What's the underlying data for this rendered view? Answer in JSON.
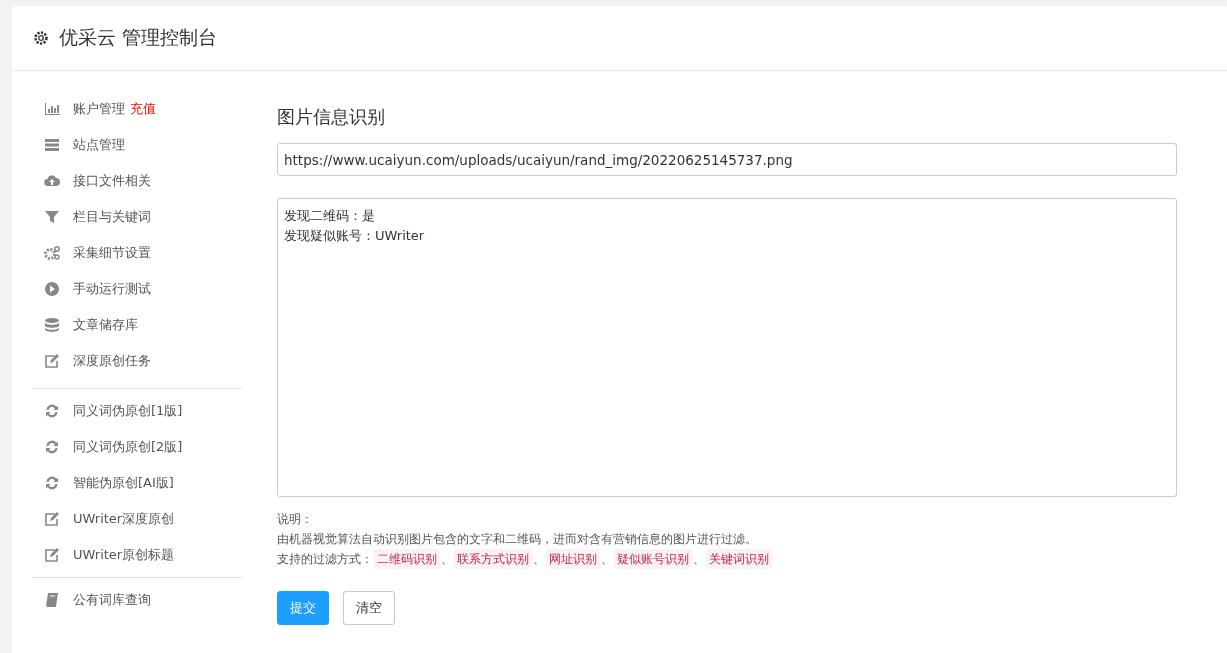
{
  "header": {
    "title": "优采云 管理控制台"
  },
  "sidebar": {
    "groups": [
      {
        "items": [
          {
            "label": "账户管理",
            "badge": "充值",
            "kind": "bars"
          },
          {
            "label": "站点管理",
            "kind": "server"
          },
          {
            "label": "接口文件相关",
            "kind": "cloud"
          },
          {
            "label": "栏目与关键词",
            "kind": "filter"
          },
          {
            "label": "采集细节设置",
            "kind": "gears"
          },
          {
            "label": "手动运行测试",
            "kind": "play"
          },
          {
            "label": "文章储存库",
            "kind": "db"
          },
          {
            "label": "深度原创任务",
            "kind": "edit"
          }
        ]
      },
      {
        "items": [
          {
            "label": "同义词伪原创[1版]",
            "kind": "refresh"
          },
          {
            "label": "同义词伪原创[2版]",
            "kind": "refresh"
          },
          {
            "label": "智能伪原创[AI版]",
            "kind": "refresh"
          },
          {
            "label": "UWriter深度原创",
            "kind": "edit"
          },
          {
            "label": "UWriter原创标题",
            "kind": "edit"
          }
        ]
      },
      {
        "items": [
          {
            "label": "公有词库查询",
            "kind": "book"
          }
        ]
      }
    ]
  },
  "main": {
    "title": "图片信息识别",
    "url_field": {
      "value": "https://www.ucaiyun.com/uploads/ucaiyun/rand_img/20220625145737.png"
    },
    "result_lines": [
      "发现二维码：是",
      "发现疑似账号：UWriter"
    ],
    "note_label": "说明：",
    "note_text": "由机器视觉算法自动识别图片包含的文字和二维码，进而对含有营销信息的图片进行过滤。",
    "filter_label": "支持的过滤方式：",
    "filters": [
      "二维码识别",
      "联系方式识别",
      "网址识别",
      "疑似账号识别",
      "关键词识别"
    ],
    "separator": "、",
    "buttons": [
      {
        "label": "提交",
        "kind": "primary"
      },
      {
        "label": "清空",
        "kind": "default"
      }
    ]
  }
}
